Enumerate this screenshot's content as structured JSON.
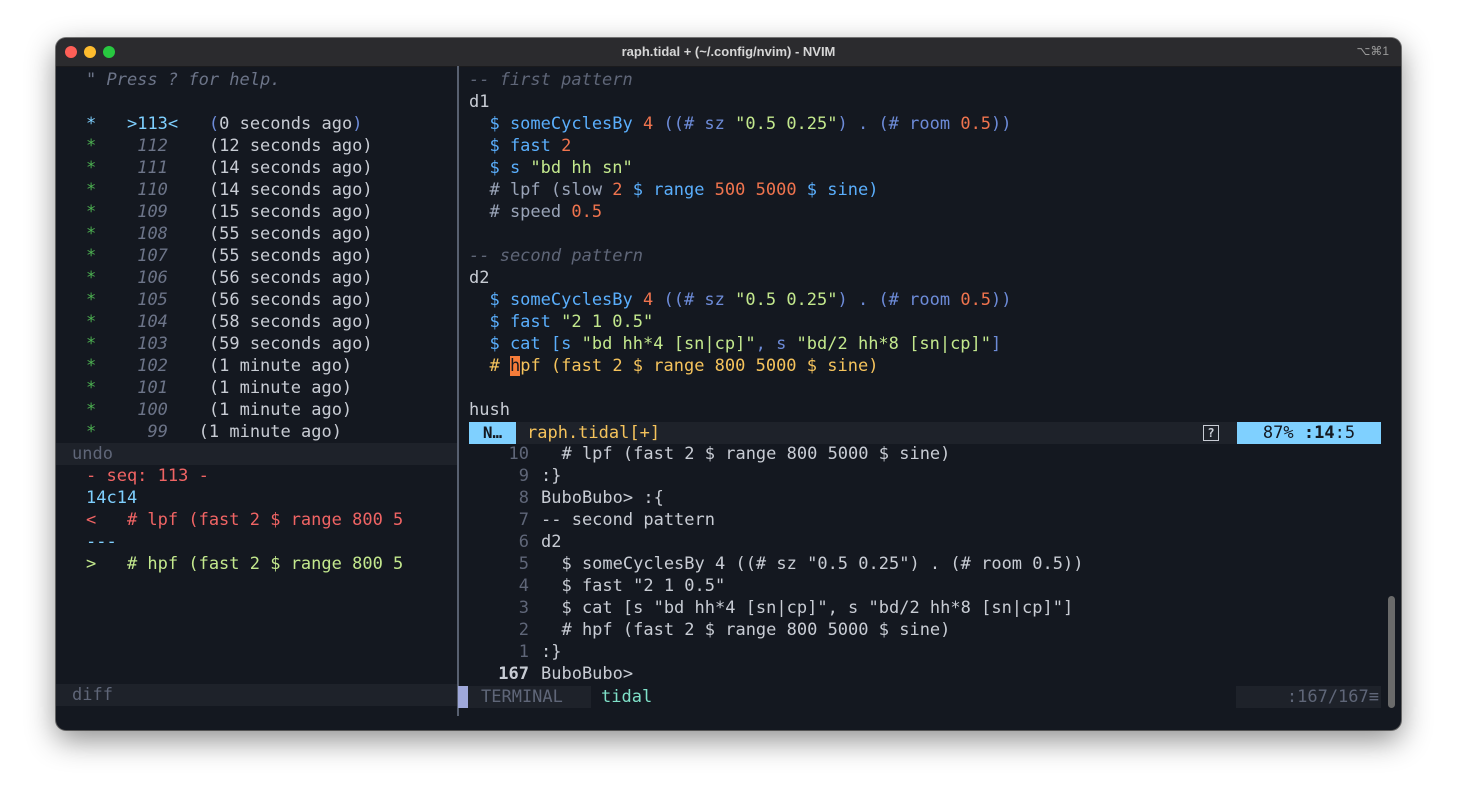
{
  "window": {
    "title": "raph.tidal + (~/.config/nvim) - NVIM",
    "shortcut": "⌥⌘1"
  },
  "undotree": {
    "help": "\" Press ? for help.",
    "entries": [
      {
        "marker": "*",
        "seq": ">113<",
        "time": "(0 seconds ago)"
      },
      {
        "marker": "*",
        "seq": "112",
        "time": "(12 seconds ago)"
      },
      {
        "marker": "*",
        "seq": "111",
        "time": "(14 seconds ago)"
      },
      {
        "marker": "*",
        "seq": "110",
        "time": "(14 seconds ago)"
      },
      {
        "marker": "*",
        "seq": "109",
        "time": "(15 seconds ago)"
      },
      {
        "marker": "*",
        "seq": "108",
        "time": "(55 seconds ago)"
      },
      {
        "marker": "*",
        "seq": "107",
        "time": "(55 seconds ago)"
      },
      {
        "marker": "*",
        "seq": "106",
        "time": "(56 seconds ago)"
      },
      {
        "marker": "*",
        "seq": "105",
        "time": "(56 seconds ago)"
      },
      {
        "marker": "*",
        "seq": "104",
        "time": "(58 seconds ago)"
      },
      {
        "marker": "*",
        "seq": "103",
        "time": "(59 seconds ago)"
      },
      {
        "marker": "*",
        "seq": "102",
        "time": "(1 minute ago)"
      },
      {
        "marker": "*",
        "seq": "101",
        "time": "(1 minute ago)"
      },
      {
        "marker": "*",
        "seq": "100",
        "time": "(1 minute ago)"
      },
      {
        "marker": "*",
        "seq": "99",
        "time": "(1 minute ago)"
      }
    ],
    "status": "undo"
  },
  "diffpanel": {
    "seq": "- seq: 113 -",
    "change": "14c14",
    "removed": "<   # lpf (fast 2 $ range 800 5",
    "sep": "---",
    "added": ">   # hpf (fast 2 $ range 800 5",
    "status": "diff"
  },
  "editor": {
    "comment1": "-- first pattern",
    "d1": "d1",
    "l1_a": "  $ someCyclesBy ",
    "l1_b": "4",
    "l1_c": " ((# sz ",
    "l1_d": "\"0.5 0.25\"",
    "l1_e": ") . (# room ",
    "l1_f": "0.5",
    "l1_g": "))",
    "l2_a": "  $ fast ",
    "l2_b": "2",
    "l3_a": "  $ s ",
    "l3_b": "\"bd hh sn\"",
    "l4_a": "  # lpf (slow ",
    "l4_b": "2",
    "l4_c": " $ range ",
    "l4_d": "500 5000",
    "l4_e": " $ sine)",
    "l5_a": "  # speed ",
    "l5_b": "0.5",
    "comment2": "-- second pattern",
    "d2": "d2",
    "m1_a": "  $ someCyclesBy ",
    "m1_b": "4",
    "m1_c": " ((# sz ",
    "m1_d": "\"0.5 0.25\"",
    "m1_e": ") . (# room ",
    "m1_f": "0.5",
    "m1_g": "))",
    "m2_a": "  $ fast ",
    "m2_b": "\"2 1 0.5\"",
    "m3_a": "  $ cat [s ",
    "m3_b": "\"bd hh*4 [sn|cp]\"",
    "m3_c": ", s ",
    "m3_d": "\"bd/2 hh*8 [sn|cp]\"",
    "m3_e": "]",
    "m4_a": "  # ",
    "m4_cursor": "h",
    "m4_b": "pf (fast 2 $ range 800 5000 $ sine)",
    "hush": "hush"
  },
  "statusline": {
    "mode": "N…",
    "file": "raph.tidal[+]",
    "help": "?",
    "percent": "87%",
    "line": ":14",
    "col": ":5"
  },
  "terminal": {
    "lines": [
      {
        "num": "10",
        "text": "  # lpf (fast 2 $ range 800 5000 $ sine)"
      },
      {
        "num": "9",
        "text": ":}"
      },
      {
        "num": "8",
        "text": "BuboBubo> :{"
      },
      {
        "num": "7",
        "text": "-- second pattern"
      },
      {
        "num": "6",
        "text": "d2"
      },
      {
        "num": "5",
        "text": "  $ someCyclesBy 4 ((# sz \"0.5 0.25\") . (# room 0.5))"
      },
      {
        "num": "4",
        "text": "  $ fast \"2 1 0.5\""
      },
      {
        "num": "3",
        "text": "  $ cat [s \"bd hh*4 [sn|cp]\", s \"bd/2 hh*8 [sn|cp]\"]"
      },
      {
        "num": "2",
        "text": "  # hpf (fast 2 $ range 800 5000 $ sine)"
      },
      {
        "num": "1",
        "text": ":}"
      },
      {
        "num": "167",
        "text": "BuboBubo>"
      }
    ],
    "label": "TERMINAL",
    "name": "tidal",
    "position": ":167/167≡"
  }
}
